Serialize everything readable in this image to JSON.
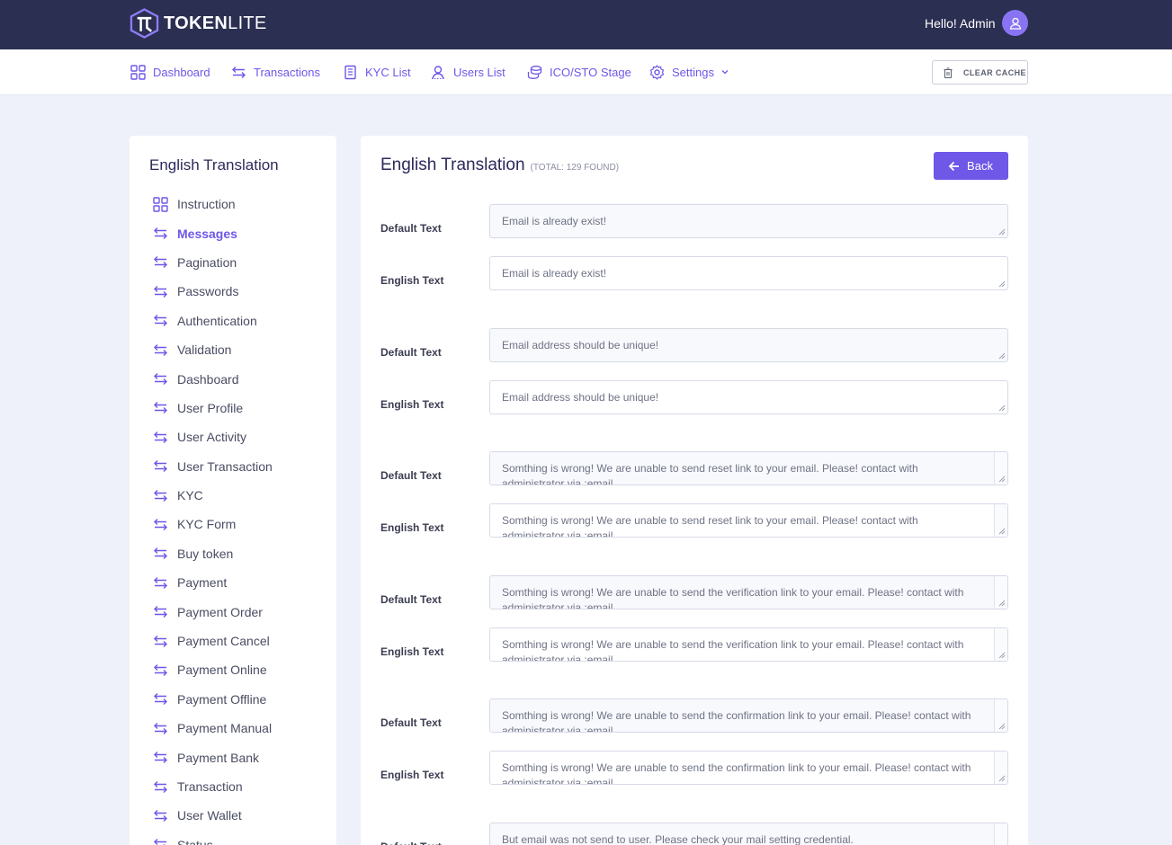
{
  "brand": {
    "part1": "TOKEN",
    "part2": "LITE",
    "accent": "#6f57e8",
    "topbar_color": "#2b2f52"
  },
  "user": {
    "greeting": "Hello! Admin",
    "avatar_icon": "user-icon"
  },
  "nav": {
    "items": [
      {
        "label": "Dashboard",
        "icon": "grid-icon"
      },
      {
        "label": "Transactions",
        "icon": "swap-icon"
      },
      {
        "label": "KYC List",
        "icon": "document-icon"
      },
      {
        "label": "Users List",
        "icon": "users-icon"
      },
      {
        "label": "ICO/STO Stage",
        "icon": "coins-icon"
      },
      {
        "label": "Settings",
        "icon": "gear-icon"
      }
    ],
    "clear_cache": "CLEAR CACHE"
  },
  "sidebar": {
    "title": "English Translation",
    "items": [
      {
        "label": "Instruction",
        "icon": "grid-icon",
        "active": false
      },
      {
        "label": "Messages",
        "icon": "swap-icon",
        "active": true
      },
      {
        "label": "Pagination",
        "icon": "swap-icon",
        "active": false
      },
      {
        "label": "Passwords",
        "icon": "swap-icon",
        "active": false
      },
      {
        "label": "Authentication",
        "icon": "swap-icon",
        "active": false
      },
      {
        "label": "Validation",
        "icon": "swap-icon",
        "active": false
      },
      {
        "label": "Dashboard",
        "icon": "swap-icon",
        "active": false
      },
      {
        "label": "User Profile",
        "icon": "swap-icon",
        "active": false
      },
      {
        "label": "User Activity",
        "icon": "swap-icon",
        "active": false
      },
      {
        "label": "User Transaction",
        "icon": "swap-icon",
        "active": false
      },
      {
        "label": "KYC",
        "icon": "swap-icon",
        "active": false
      },
      {
        "label": "KYC Form",
        "icon": "swap-icon",
        "active": false
      },
      {
        "label": "Buy token",
        "icon": "swap-icon",
        "active": false
      },
      {
        "label": "Payment",
        "icon": "swap-icon",
        "active": false
      },
      {
        "label": "Payment Order",
        "icon": "swap-icon",
        "active": false
      },
      {
        "label": "Payment Cancel",
        "icon": "swap-icon",
        "active": false
      },
      {
        "label": "Payment Online",
        "icon": "swap-icon",
        "active": false
      },
      {
        "label": "Payment Offline",
        "icon": "swap-icon",
        "active": false
      },
      {
        "label": "Payment Manual",
        "icon": "swap-icon",
        "active": false
      },
      {
        "label": "Payment Bank",
        "icon": "swap-icon",
        "active": false
      },
      {
        "label": "Transaction",
        "icon": "swap-icon",
        "active": false
      },
      {
        "label": "User Wallet",
        "icon": "swap-icon",
        "active": false
      },
      {
        "label": "Status",
        "icon": "swap-icon",
        "active": false
      }
    ]
  },
  "main": {
    "title": "English Translation",
    "total": "(TOTAL: 129 FOUND)",
    "back_label": "Back",
    "default_label": "Default Text",
    "english_label": "English Text",
    "entries": [
      {
        "default": "Email is already exist!",
        "english": "Email is already exist!"
      },
      {
        "default": "Email address should be unique!",
        "english": "Email address should be unique!"
      },
      {
        "default": "Somthing is wrong! We are unable to send reset link to your email. Please! contact with administrator via :email.",
        "english": "Somthing is wrong! We are unable to send reset link to your email. Please! contact with administrator via :email."
      },
      {
        "default": "Somthing is wrong! We are unable to send the verification link to your email. Please! contact with administrator via :email.",
        "english": "Somthing is wrong! We are unable to send the verification link to your email. Please! contact with administrator via :email."
      },
      {
        "default": "Somthing is wrong! We are unable to send the confirmation link to your email. Please! contact with administrator via :email.",
        "english": "Somthing is wrong! We are unable to send the confirmation link to your email. Please! contact with administrator via :email."
      },
      {
        "default": "But email was not send to user. Please check your mail setting credential."
      }
    ]
  }
}
